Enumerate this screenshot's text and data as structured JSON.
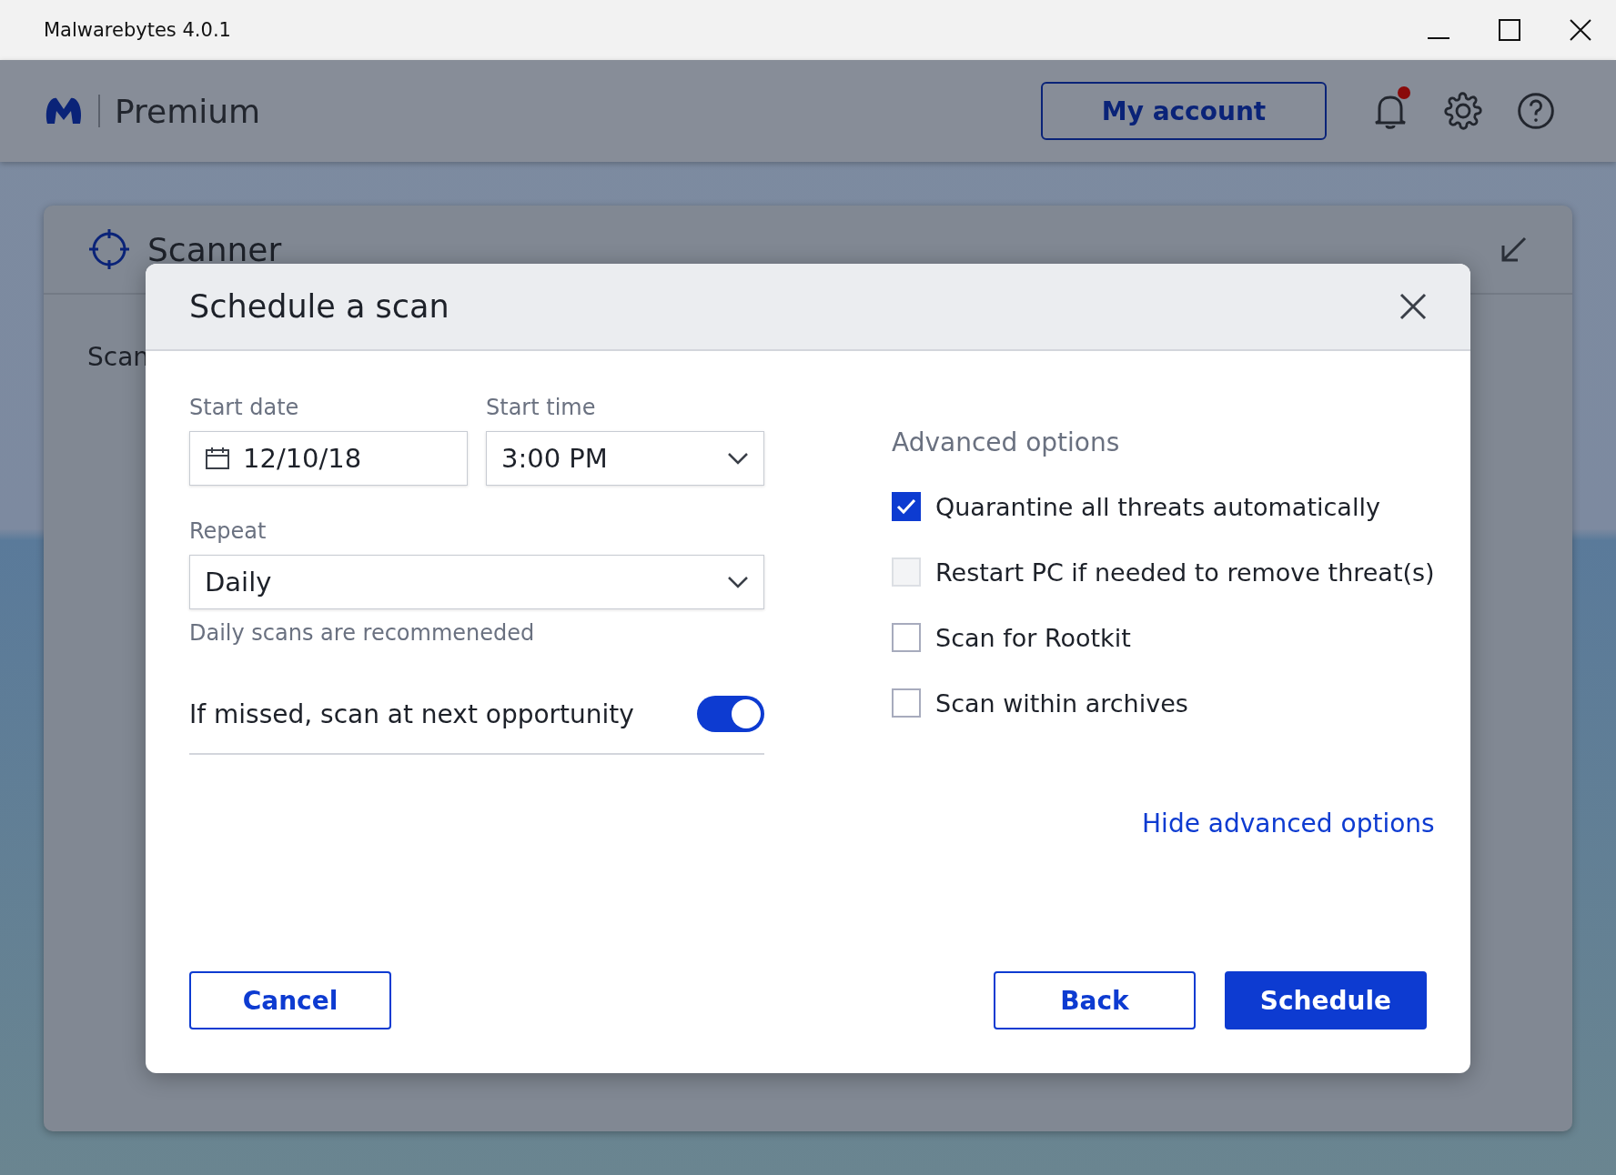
{
  "window": {
    "title": "Malwarebytes 4.0.1"
  },
  "header": {
    "product": "Premium",
    "account_button": "My account",
    "notification_unread": true
  },
  "scanner_card": {
    "title": "Scanner",
    "tab_label": "Scan"
  },
  "dialog": {
    "title": "Schedule a scan",
    "start_date": {
      "label": "Start date",
      "value": "12/10/18"
    },
    "start_time": {
      "label": "Start time",
      "value": "3:00 PM"
    },
    "repeat": {
      "label": "Repeat",
      "value": "Daily",
      "hint": "Daily scans are recommeneded"
    },
    "missed_toggle": {
      "label": "If missed, scan at next opportunity",
      "on": true
    },
    "advanced": {
      "title": "Advanced options",
      "options": [
        {
          "label": "Quarantine all threats automatically",
          "checked": true,
          "disabled": false
        },
        {
          "label": "Restart PC if needed to remove threat(s)",
          "checked": false,
          "disabled": true
        },
        {
          "label": "Scan for Rootkit",
          "checked": false,
          "disabled": false
        },
        {
          "label": "Scan within archives",
          "checked": false,
          "disabled": false
        }
      ],
      "toggle_link": "Hide advanced options"
    },
    "buttons": {
      "cancel": "Cancel",
      "back": "Back",
      "schedule": "Schedule"
    }
  }
}
